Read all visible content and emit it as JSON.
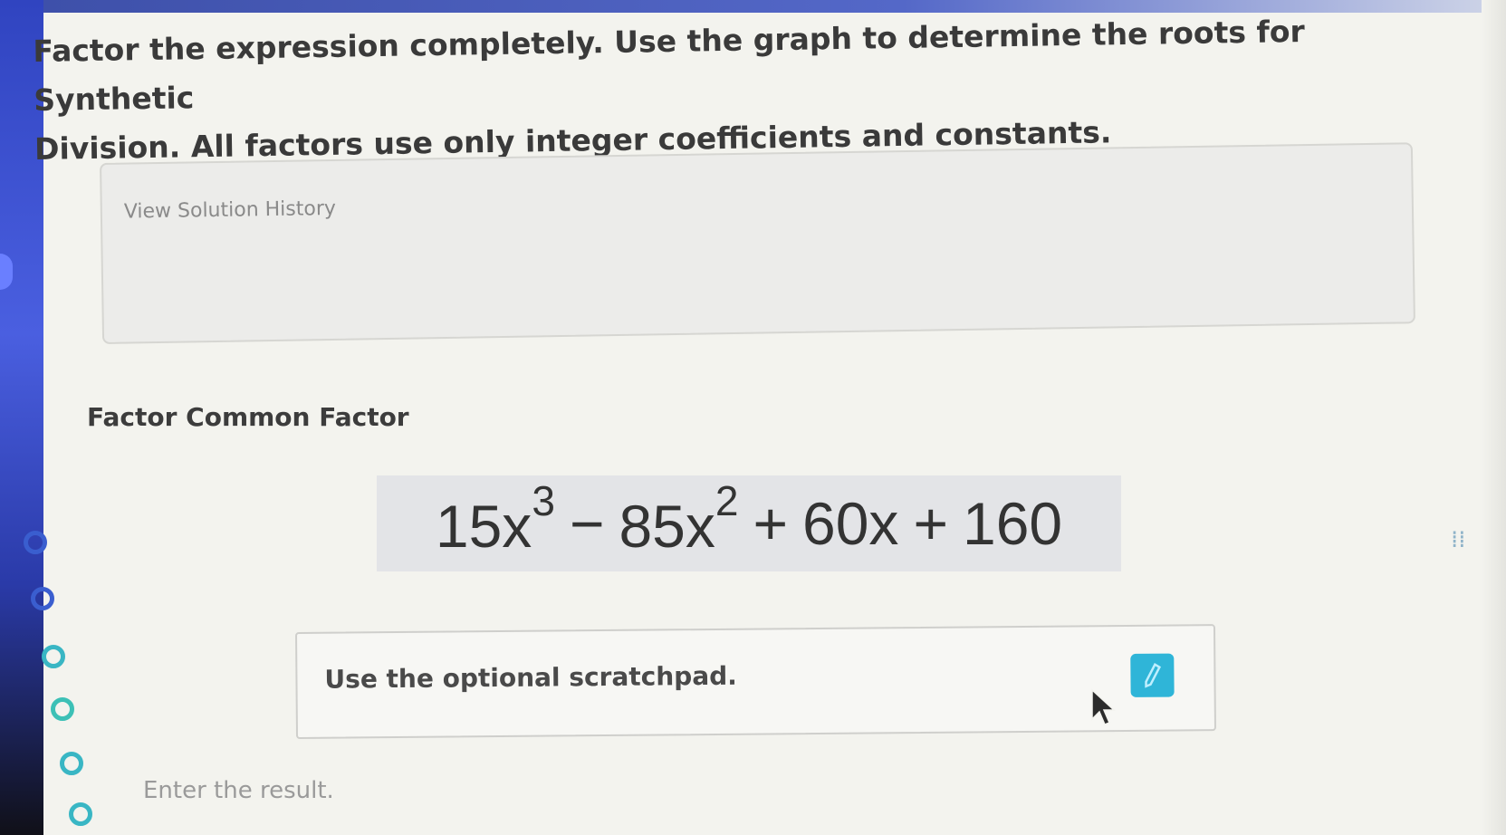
{
  "question": {
    "line1": "Factor the expression completely. Use the graph to determine the roots for Synthetic",
    "line2": "Division. All factors use only integer coefficients and constants."
  },
  "history": {
    "link_label": "View Solution History"
  },
  "step": {
    "title": "Factor Common Factor"
  },
  "expression": {
    "term1_coef": "15x",
    "term1_exp": "3",
    "op1": "−",
    "term2_coef": "85x",
    "term2_exp": "2",
    "op2": "+",
    "term3": "60x",
    "op3": "+",
    "term4": "160"
  },
  "scratchpad": {
    "label": "Use the optional scratchpad.",
    "icon": "pencil-icon"
  },
  "result": {
    "placeholder": "Enter the result."
  },
  "progress_rail": {
    "icons": [
      "partial-circle-icon",
      "circle-icon",
      "circle-icon",
      "circle-icon",
      "partial-circle-icon",
      "partial-circle-icon"
    ]
  },
  "colors": {
    "rail": "#3044c0",
    "accent": "#2fb5d8",
    "expression_bg": "#e3e4e7"
  }
}
